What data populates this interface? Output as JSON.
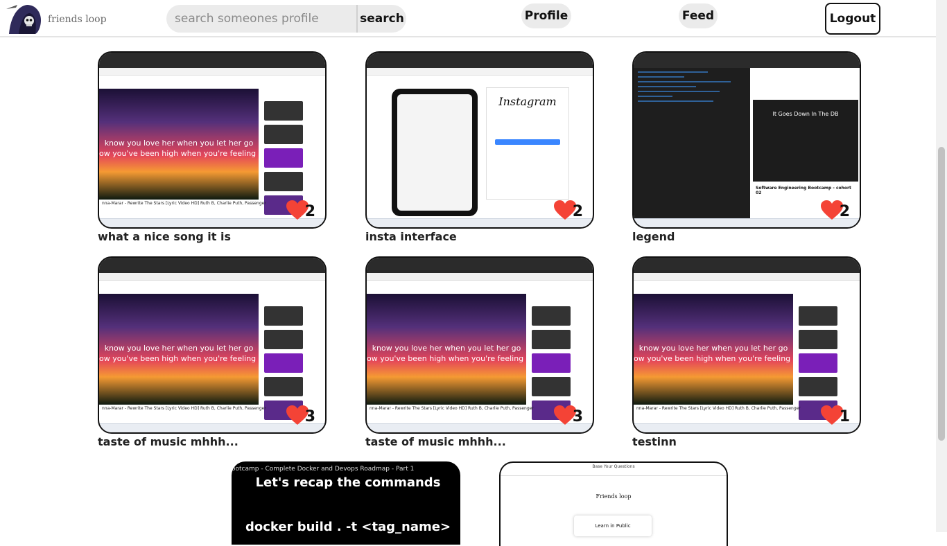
{
  "app": {
    "brand": "friends loop"
  },
  "nav": {
    "search_placeholder": "search someones profile",
    "search_label": "search",
    "profile_label": "Profile",
    "feed_label": "Feed",
    "logout_label": "Logout"
  },
  "posts": [
    {
      "caption": "what a nice song it is",
      "likes": "2",
      "kind": "song"
    },
    {
      "caption": "insta interface",
      "likes": "2",
      "kind": "insta"
    },
    {
      "caption": "legend",
      "likes": "2",
      "kind": "code"
    },
    {
      "caption": "taste of music mhhh...",
      "likes": "3",
      "kind": "song"
    },
    {
      "caption": "taste of music mhhh...",
      "likes": "3",
      "kind": "song"
    },
    {
      "caption": "testinn",
      "likes": "1",
      "kind": "song"
    }
  ],
  "thumbs": {
    "song_line1": "know you love her when you let her go",
    "song_line2": "ow you've been high when you're feeling low",
    "song_caption": "nna-Marar - Rewrite The Stars [Lyric Video HD] Ruth B, Charlie Puth, Passenger",
    "insta_title": "Instagram",
    "code_video_title": "It Goes Down In The DB",
    "code_course_title": "Software Engineering Bootcamp - cohort 02"
  },
  "partial_posts": {
    "docker_top": "ootcamp - Complete Docker and Devops Roadmap - Part 1",
    "docker_heading": "Let's recap the commands",
    "docker_command": "docker build . -t <tag_name>",
    "fl_tab": "Base Your Questions",
    "fl_title": "Friends loop",
    "fl_button": "Learn in Public"
  },
  "colors": {
    "heart": "#f44336",
    "accent": "#111111"
  }
}
